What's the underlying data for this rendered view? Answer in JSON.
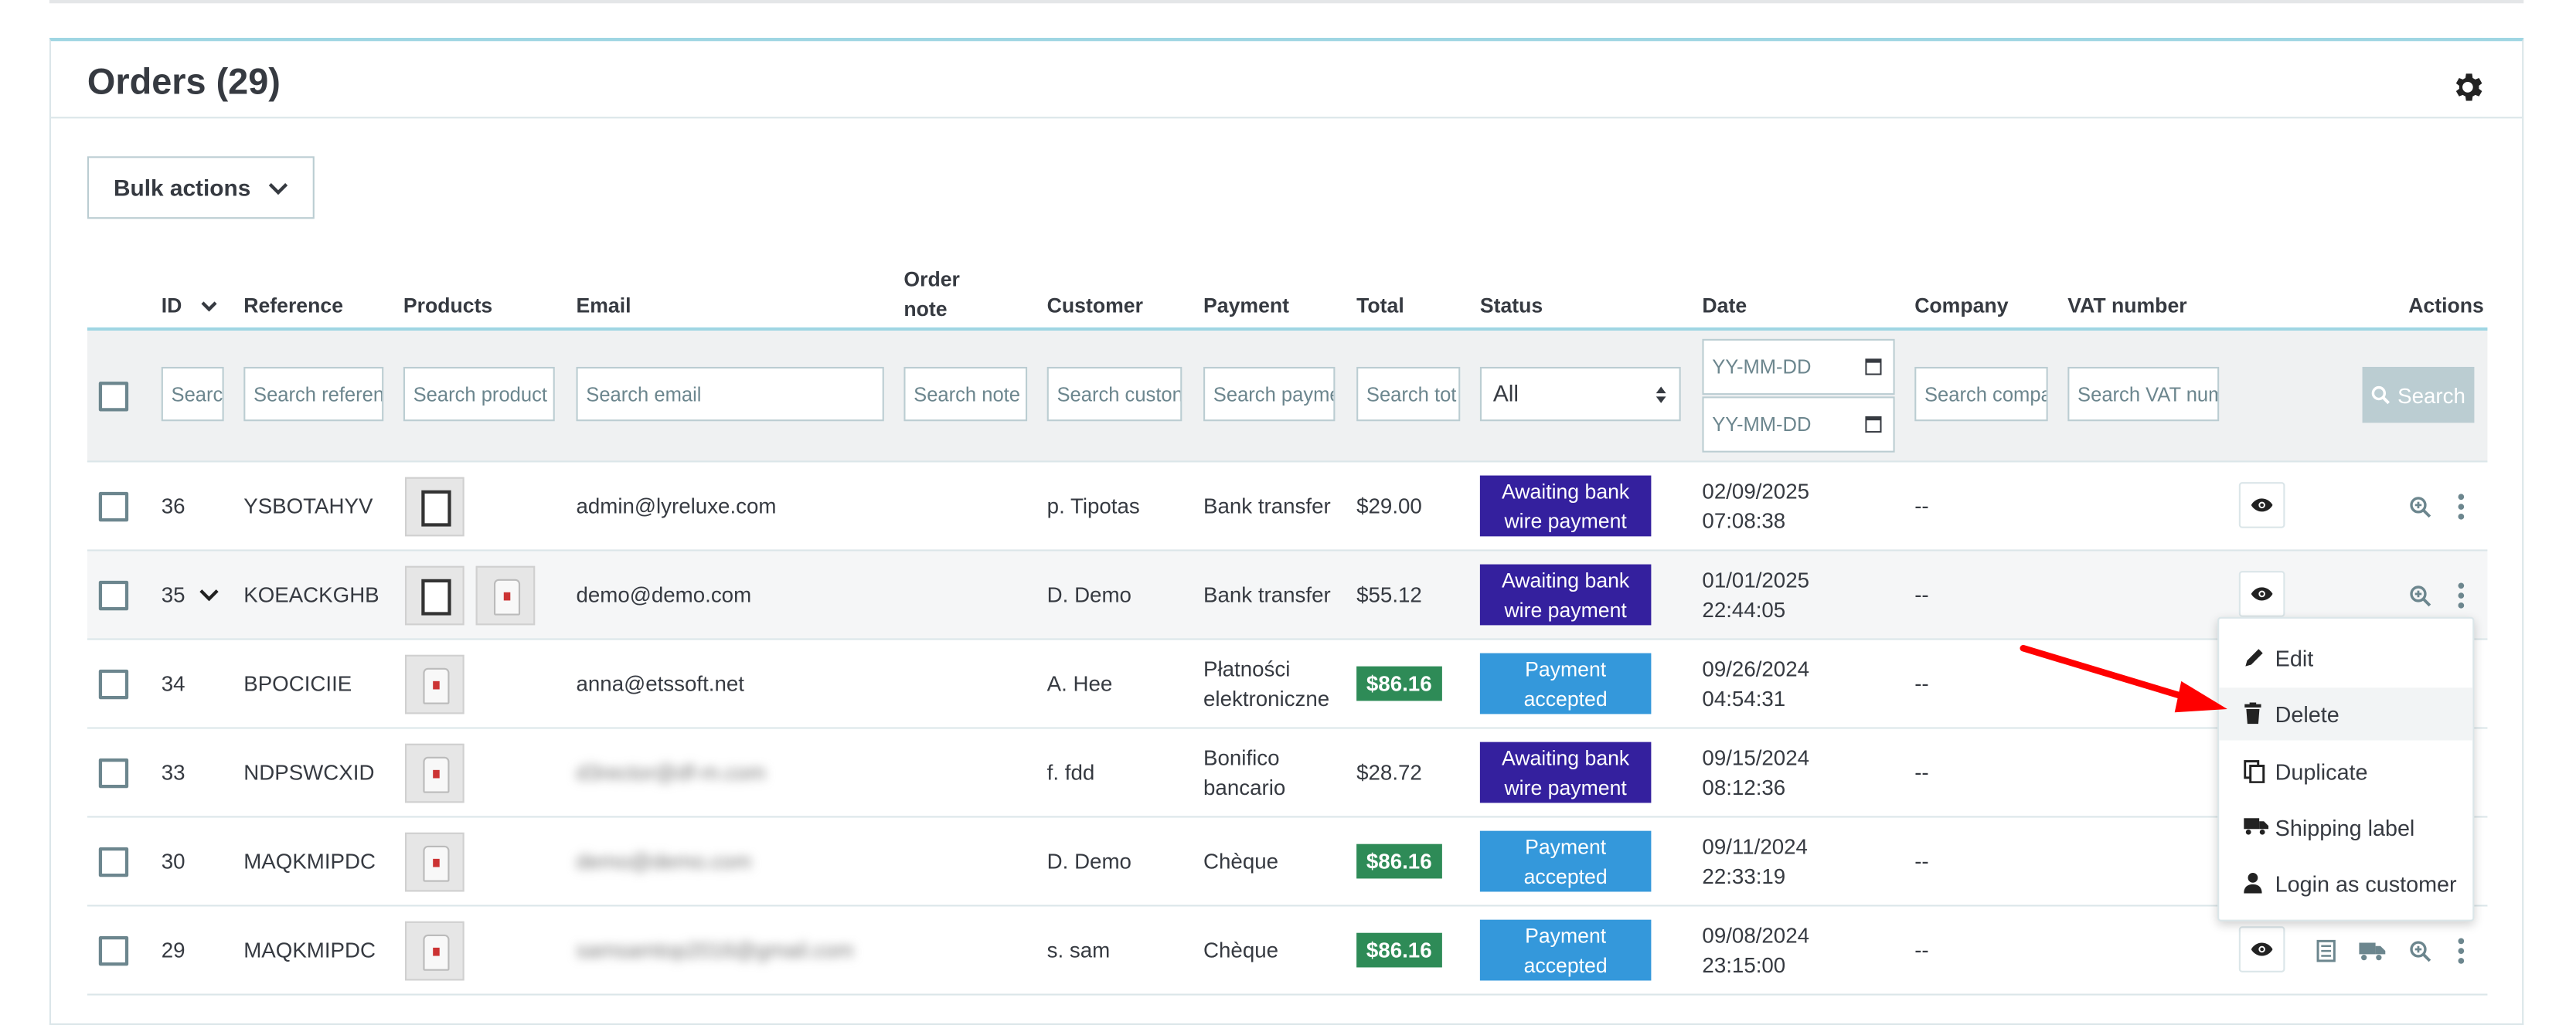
{
  "card": {
    "title": "Orders (29)"
  },
  "bulk_actions": {
    "label": "Bulk actions"
  },
  "columns": {
    "id": "ID",
    "reference": "Reference",
    "products": "Products",
    "email": "Email",
    "order_note_1": "Order",
    "order_note_2": "note",
    "customer": "Customer",
    "payment": "Payment",
    "total": "Total",
    "status": "Status",
    "date": "Date",
    "company": "Company",
    "vat": "VAT number",
    "actions": "Actions"
  },
  "filters": {
    "id": "Searc",
    "reference": "Search referen",
    "products": "Search product",
    "email": "Search email",
    "order_note": "Search note",
    "customer": "Search custon",
    "payment": "Search payme",
    "total": "Search tot",
    "status": "All",
    "date_from": "YY-MM-DD",
    "date_to": "YY-MM-DD",
    "company": "Search compa",
    "vat": "Search VAT num",
    "search_button": "Search"
  },
  "rows": [
    {
      "id": "36",
      "reference": "YSBOTAHYV",
      "email": "admin@lyreluxe.com",
      "customer": "p. Tipotas",
      "payment": "Bank transfer",
      "total": "$29.00",
      "status_1": "Awaiting bank",
      "status_2": "wire payment",
      "date": "02/09/2025",
      "time": "07:08:38",
      "company": "--"
    },
    {
      "id": "35",
      "reference": "KOEACKGHB",
      "email": "demo@demo.com",
      "customer": "D. Demo",
      "payment": "Bank transfer",
      "total": "$55.12",
      "status_1": "Awaiting bank",
      "status_2": "wire payment",
      "date": "01/01/2025",
      "time": "22:44:05",
      "company": "--"
    },
    {
      "id": "34",
      "reference": "BPOCICIIE",
      "email": "anna@etssoft.net",
      "customer": "A. Hee",
      "payment_1": "Płatności",
      "payment_2": "elektroniczne",
      "total": "$86.16",
      "status_1": "Payment",
      "status_2": "accepted",
      "date": "09/26/2024",
      "time": "04:54:31",
      "company": "--"
    },
    {
      "id": "33",
      "reference": "NDPSWCXID",
      "email": "d3rector@df-m.com",
      "customer": "f. fdd",
      "payment_1": "Bonifico",
      "payment_2": "bancario",
      "total": "$28.72",
      "status_1": "Awaiting bank",
      "status_2": "wire payment",
      "date": "09/15/2024",
      "time": "08:12:36",
      "company": "--"
    },
    {
      "id": "30",
      "reference": "MAQKMIPDC",
      "email": "demo@demo.com",
      "customer": "D. Demo",
      "payment": "Chèque",
      "total": "$86.16",
      "status_1": "Payment",
      "status_2": "accepted",
      "date": "09/11/2024",
      "time": "22:33:19",
      "company": "--"
    },
    {
      "id": "29",
      "reference": "MAQKMIPDC",
      "email": "samsamtop2016@gmail.com",
      "customer": "s. sam",
      "payment": "Chèque",
      "total": "$86.16",
      "status_1": "Payment",
      "status_2": "accepted",
      "date": "09/08/2024",
      "time": "23:15:00",
      "company": "--"
    }
  ],
  "dropdown": {
    "edit": "Edit",
    "delete": "Delete",
    "duplicate": "Duplicate",
    "shipping_label": "Shipping label",
    "login_as_customer": "Login as customer"
  },
  "colors": {
    "awaiting": "#34209e",
    "accepted": "#3498db",
    "paid_total": "#2e8b57",
    "arrow": "#ff0000"
  }
}
